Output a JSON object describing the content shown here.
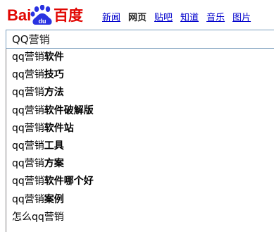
{
  "logo": {
    "text_left": "Bai",
    "text_right": "百度",
    "paw_text": "du"
  },
  "nav": [
    {
      "label": "新闻",
      "current": false
    },
    {
      "label": "网页",
      "current": true
    },
    {
      "label": "贴吧",
      "current": false
    },
    {
      "label": "知道",
      "current": false
    },
    {
      "label": "音乐",
      "current": false
    },
    {
      "label": "图片",
      "current": false
    }
  ],
  "search": {
    "value": "QQ营销"
  },
  "suggestions": [
    {
      "query": "qq营销",
      "rest": "软件"
    },
    {
      "query": "qq营销",
      "rest": "技巧"
    },
    {
      "query": "qq营销",
      "rest": "方法"
    },
    {
      "query": "qq营销",
      "rest": "软件破解版"
    },
    {
      "query": "qq营销",
      "rest": "软件站"
    },
    {
      "query": "qq营销",
      "rest": "工具"
    },
    {
      "query": "qq营销",
      "rest": "方案"
    },
    {
      "query": "qq营销",
      "rest": "软件哪个好"
    },
    {
      "query": "qq营销",
      "rest": "案例"
    },
    {
      "query": "怎么qq营销",
      "rest": ""
    }
  ],
  "colors": {
    "logo_red": "#e10602",
    "logo_blue": "#2932e1",
    "link": "#0000cc",
    "input_border": "#7b9ebd"
  }
}
